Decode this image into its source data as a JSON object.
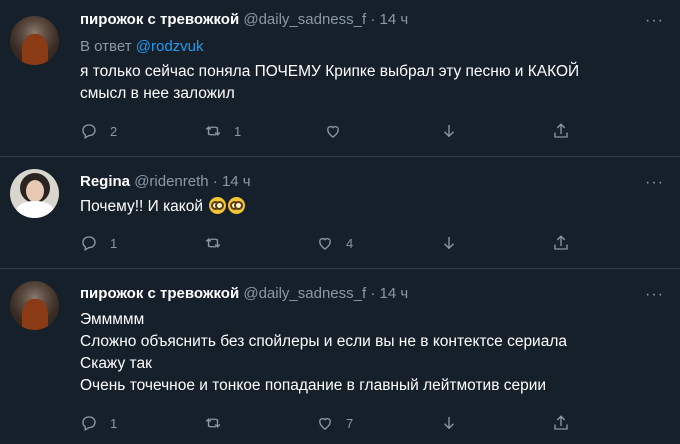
{
  "tweets": [
    {
      "name": "пирожок с тревожкой",
      "handle": "@daily_sadness_f",
      "time": "· 14 ч",
      "reply_prefix": "В ответ",
      "reply_mention": "@rodzvuk",
      "lines": [
        "я только сейчас поняла ПОЧЕМУ Крипке  выбрал эту песню и КАКОЙ",
        "смысл в нее заложил"
      ],
      "replies": "2",
      "retweets": "1",
      "likes": ""
    },
    {
      "name": "Regina",
      "handle": "@ridenreth",
      "time": "· 14 ч",
      "lines": [
        "Почему!! И какой"
      ],
      "emojis": [
        "face-with-monocle",
        "face-with-monocle"
      ],
      "replies": "1",
      "retweets": "",
      "likes": "4"
    },
    {
      "name": "пирожок с тревожкой",
      "handle": "@daily_sadness_f",
      "time": "· 14 ч",
      "lines": [
        "Эммммм",
        "Сложно объяснить без спойлеры и если вы не в контектсе сериала",
        "Скажу так",
        "Очень точечное и тонкое попадание в главный лейтмотив серии"
      ],
      "replies": "1",
      "retweets": "",
      "likes": "7"
    }
  ],
  "more_glyph": "···",
  "colors": {
    "background": "#15202b",
    "text": "#ffffff",
    "secondary": "#8b98a5",
    "link": "#1d9bf0",
    "divider": "#2f3b47"
  }
}
